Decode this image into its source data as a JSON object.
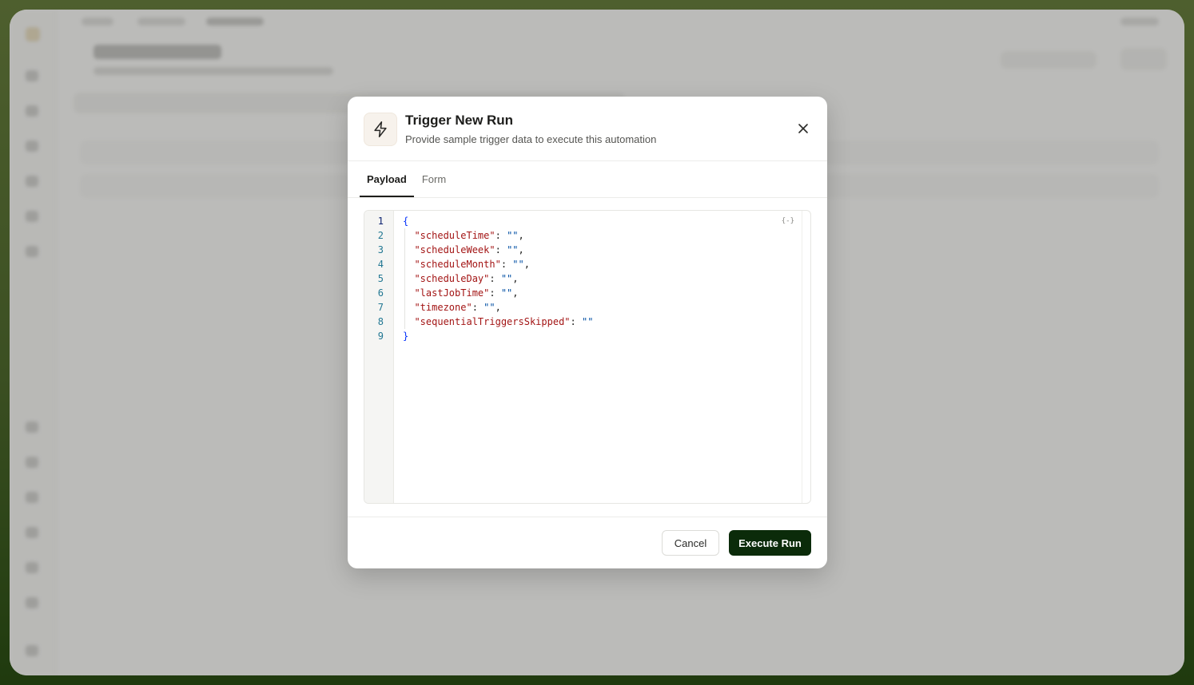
{
  "modal": {
    "title": "Trigger New Run",
    "subtitle": "Provide sample trigger data to execute this automation",
    "header_icon": "lightning-bolt-icon",
    "close_icon": "close-icon"
  },
  "tabs": [
    {
      "label": "Payload",
      "active": true
    },
    {
      "label": "Form",
      "active": false
    }
  ],
  "editor": {
    "line_numbers": [
      "1",
      "2",
      "3",
      "4",
      "5",
      "6",
      "7",
      "8",
      "9"
    ],
    "open_brace": "{",
    "close_brace": "}",
    "fields": [
      {
        "key": "\"scheduleTime\"",
        "value": "\"\"",
        "sep": ","
      },
      {
        "key": "\"scheduleWeek\"",
        "value": "\"\"",
        "sep": ","
      },
      {
        "key": "\"scheduleMonth\"",
        "value": "\"\"",
        "sep": ","
      },
      {
        "key": "\"scheduleDay\"",
        "value": "\"\"",
        "sep": ","
      },
      {
        "key": "\"lastJobTime\"",
        "value": "\"\"",
        "sep": ","
      },
      {
        "key": "\"timezone\"",
        "value": "\"\"",
        "sep": ","
      },
      {
        "key": "\"sequentialTriggersSkipped\"",
        "value": "\"\"",
        "sep": ""
      }
    ],
    "colon": ": ",
    "fold_label": "{-}"
  },
  "footer": {
    "cancel_label": "Cancel",
    "execute_label": "Execute Run"
  },
  "colors": {
    "execute_bg": "#0b2b0a",
    "key_color": "#a31515",
    "string_color": "#0451a5",
    "brace_color": "#0431fa"
  }
}
